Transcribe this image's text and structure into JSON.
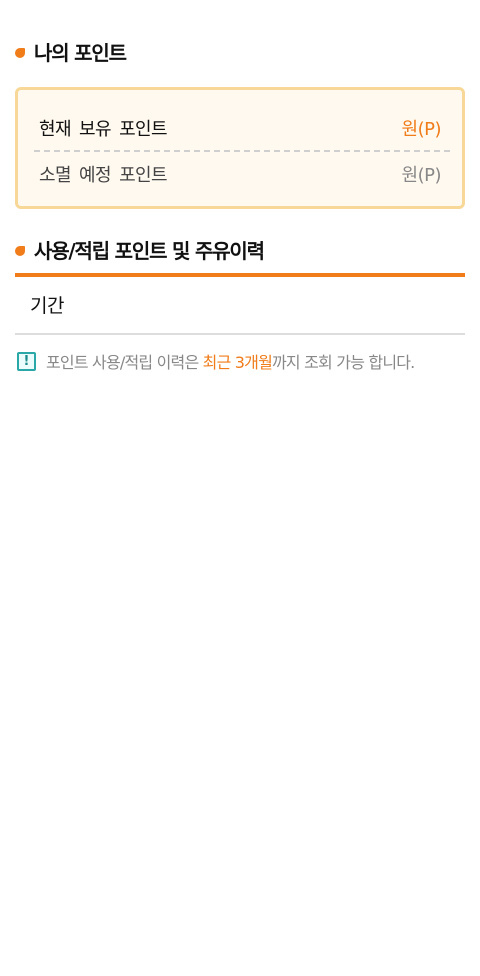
{
  "my_points": {
    "title": "나의 포인트",
    "current_label": "현재 보유 포인트",
    "current_value": "원(P)",
    "expire_label": "소멸 예정 포인트",
    "expire_value": "원(P)"
  },
  "history": {
    "title": "사용/적립 포인트 및 주유이력",
    "period_label": "기간"
  },
  "notice": {
    "icon": "exclamation-icon",
    "text_before": "포인트 사용/적립 이력은 ",
    "text_highlight": "최근 3개월",
    "text_after": "까지 조회 가능 합니다."
  },
  "colors": {
    "accent": "#f07c1a",
    "box_border": "#f8d898",
    "box_bg": "#fff9ef",
    "notice_icon": "#2aa8a8"
  }
}
